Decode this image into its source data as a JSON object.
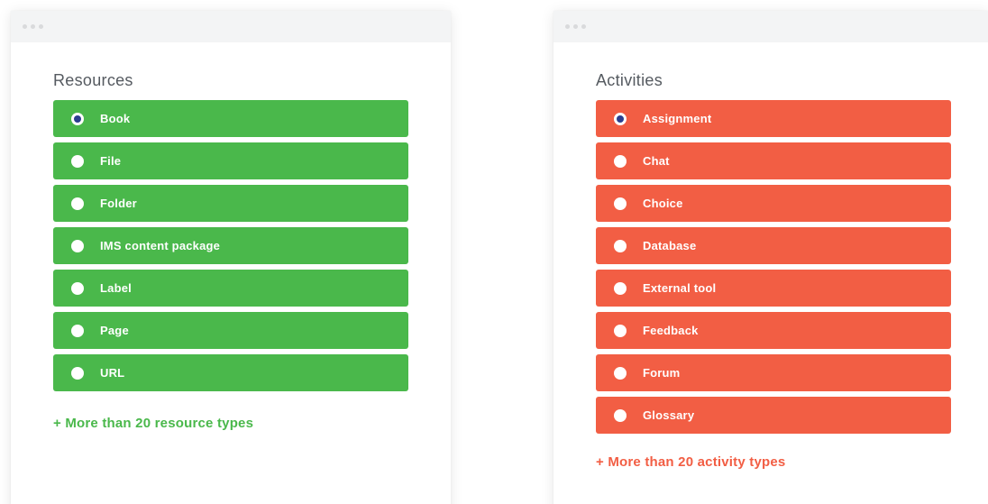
{
  "colors": {
    "resources_accent": "#4ab84b",
    "activities_accent": "#f25e44",
    "radio_selected": "#2b3e8f"
  },
  "resources": {
    "title": "Resources",
    "items": [
      {
        "label": "Book",
        "selected": true
      },
      {
        "label": "File",
        "selected": false
      },
      {
        "label": "Folder",
        "selected": false
      },
      {
        "label": "IMS content package",
        "selected": false
      },
      {
        "label": "Label",
        "selected": false
      },
      {
        "label": "Page",
        "selected": false
      },
      {
        "label": "URL",
        "selected": false
      }
    ],
    "more_link": "+ More than 20 resource types"
  },
  "activities": {
    "title": "Activities",
    "items": [
      {
        "label": "Assignment",
        "selected": true
      },
      {
        "label": "Chat",
        "selected": false
      },
      {
        "label": "Choice",
        "selected": false
      },
      {
        "label": "Database",
        "selected": false
      },
      {
        "label": "External tool",
        "selected": false
      },
      {
        "label": "Feedback",
        "selected": false
      },
      {
        "label": "Forum",
        "selected": false
      },
      {
        "label": "Glossary",
        "selected": false
      }
    ],
    "more_link": "+ More than 20 activity types"
  }
}
